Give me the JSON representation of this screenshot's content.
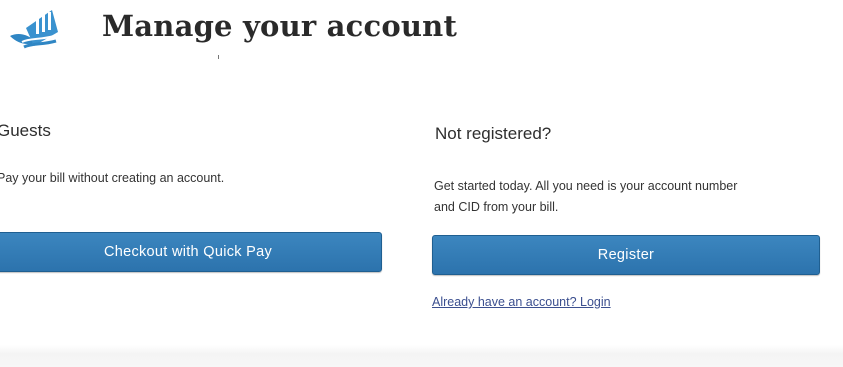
{
  "header": {
    "title": "Manage your account",
    "logo_icon": "water-tower-logo-icon"
  },
  "guests": {
    "heading": "Guests",
    "description": "Pay your bill without creating an account.",
    "button_label": "Checkout with Quick Pay"
  },
  "register": {
    "heading": "Not registered?",
    "description_line1": "Get started today. All you need is your account number",
    "description_line2": "and CID from your bill.",
    "button_label": "Register",
    "login_link": "Already have an account? Login"
  },
  "colors": {
    "button": "#2f78b4",
    "link": "#3b4f8f",
    "logo": "#2f86c4"
  }
}
